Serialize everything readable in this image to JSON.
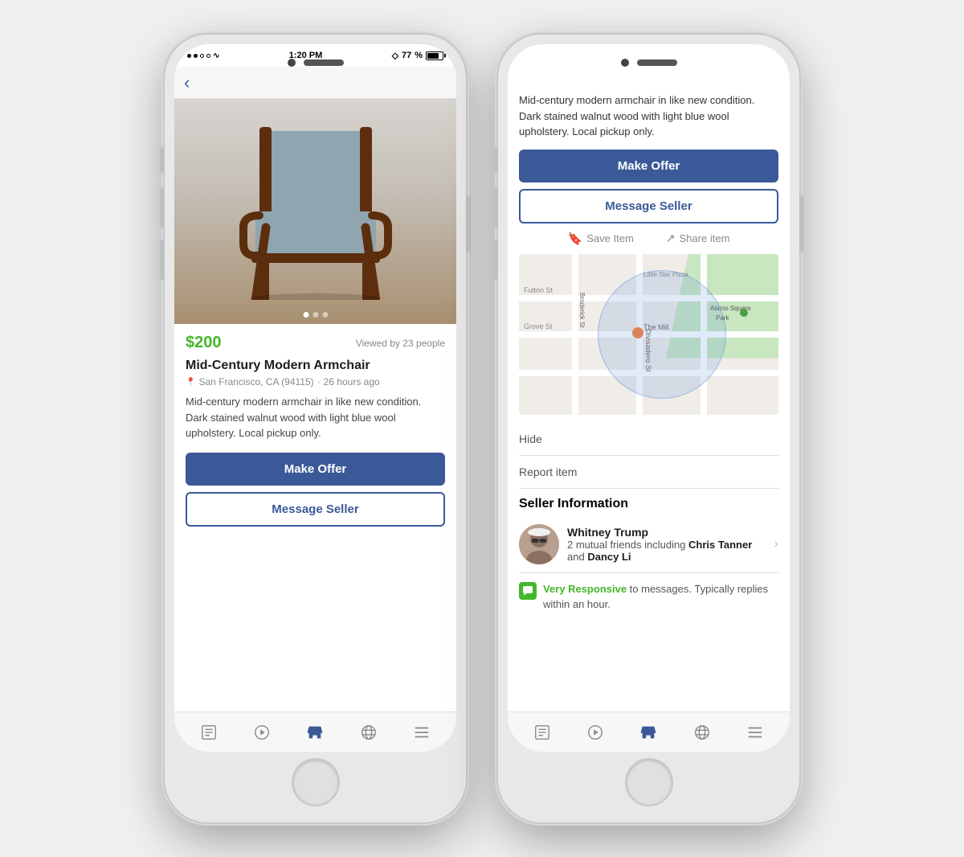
{
  "phone1": {
    "status": {
      "time": "1:20 PM",
      "battery_pct": 77,
      "bluetooth": true
    },
    "product": {
      "price": "$200",
      "viewed_by": "Viewed by 23 people",
      "title": "Mid-Century Modern Armchair",
      "location": "San Francisco, CA (94115)",
      "time_ago": "26 hours ago",
      "description": "Mid-century modern armchair in like new condition. Dark stained walnut wood with light blue wool upholstery. Local pickup only.",
      "make_offer_label": "Make Offer",
      "message_seller_label": "Message Seller"
    },
    "image_dots": [
      "active",
      "inactive",
      "inactive"
    ]
  },
  "phone2": {
    "top_description": "Mid-century modern armchair in like new condition. Dark stained walnut wood with light blue wool upholstery. Local pickup only.",
    "make_offer_label": "Make Offer",
    "message_seller_label": "Message Seller",
    "save_item_label": "Save Item",
    "share_item_label": "Share item",
    "map": {
      "street_labels": [
        "Fulton St",
        "Grove St",
        "The Mill",
        "Alamo Square Park",
        "Little Star Pizza",
        "Divisadero St",
        "Broderick St"
      ]
    },
    "hide_label": "Hide",
    "report_label": "Report item",
    "seller_section_title": "Seller Information",
    "seller": {
      "name": "Whitney Trump",
      "mutual_friends_text": "2 mutual friends including",
      "friend1": "Chris Tanner",
      "and_text": "and",
      "friend2": "Dancy Li"
    },
    "responsive": {
      "badge": "Very Responsive",
      "text": " to messages. Typically replies within an hour."
    }
  },
  "tab_icons": {
    "news": "news-icon",
    "play": "play-icon",
    "marketplace": "marketplace-icon",
    "globe": "globe-icon",
    "menu": "menu-icon"
  }
}
